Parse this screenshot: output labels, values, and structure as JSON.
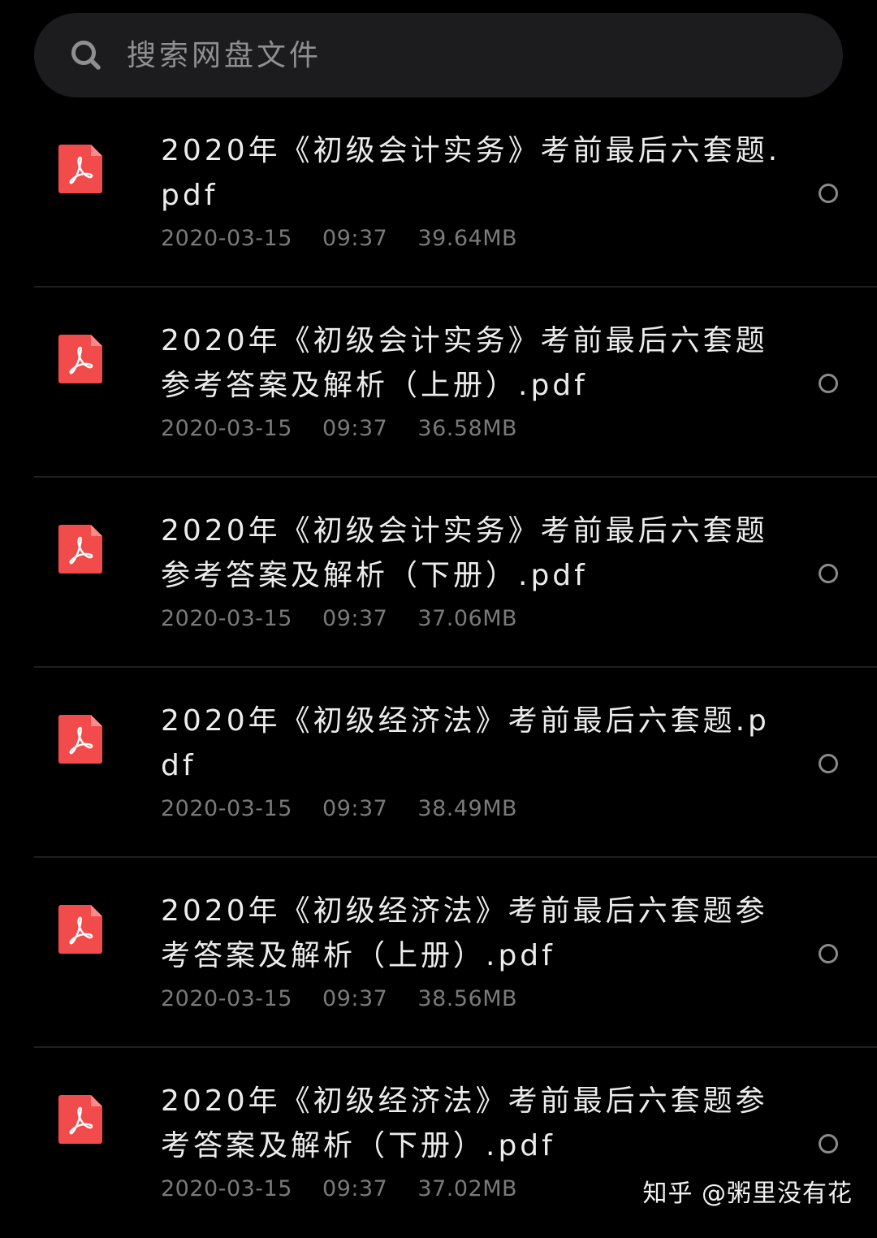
{
  "search": {
    "placeholder": "搜索网盘文件"
  },
  "colors": {
    "background": "#000000",
    "search_bg": "#1c1c1e",
    "pdf_red": "#f24b4b",
    "text_primary": "#ececec",
    "text_secondary": "#7a7a7a"
  },
  "files": [
    {
      "icon": "pdf-icon",
      "name": "2020年《初级会计实务》考前最后六套题.pdf",
      "date": "2020-03-15",
      "time": "09:37",
      "size": "39.64MB"
    },
    {
      "icon": "pdf-icon",
      "name": "2020年《初级会计实务》考前最后六套题参考答案及解析（上册）.pdf",
      "date": "2020-03-15",
      "time": "09:37",
      "size": "36.58MB"
    },
    {
      "icon": "pdf-icon",
      "name": "2020年《初级会计实务》考前最后六套题参考答案及解析（下册）.pdf",
      "date": "2020-03-15",
      "time": "09:37",
      "size": "37.06MB"
    },
    {
      "icon": "pdf-icon",
      "name": "2020年《初级经济法》考前最后六套题.pdf",
      "date": "2020-03-15",
      "time": "09:37",
      "size": "38.49MB"
    },
    {
      "icon": "pdf-icon",
      "name": "2020年《初级经济法》考前最后六套题参考答案及解析（上册）.pdf",
      "date": "2020-03-15",
      "time": "09:37",
      "size": "38.56MB"
    },
    {
      "icon": "pdf-icon",
      "name": "2020年《初级经济法》考前最后六套题参考答案及解析（下册）.pdf",
      "date": "2020-03-15",
      "time": "09:37",
      "size": "37.02MB"
    }
  ],
  "watermark": "知乎 @粥里没有花"
}
